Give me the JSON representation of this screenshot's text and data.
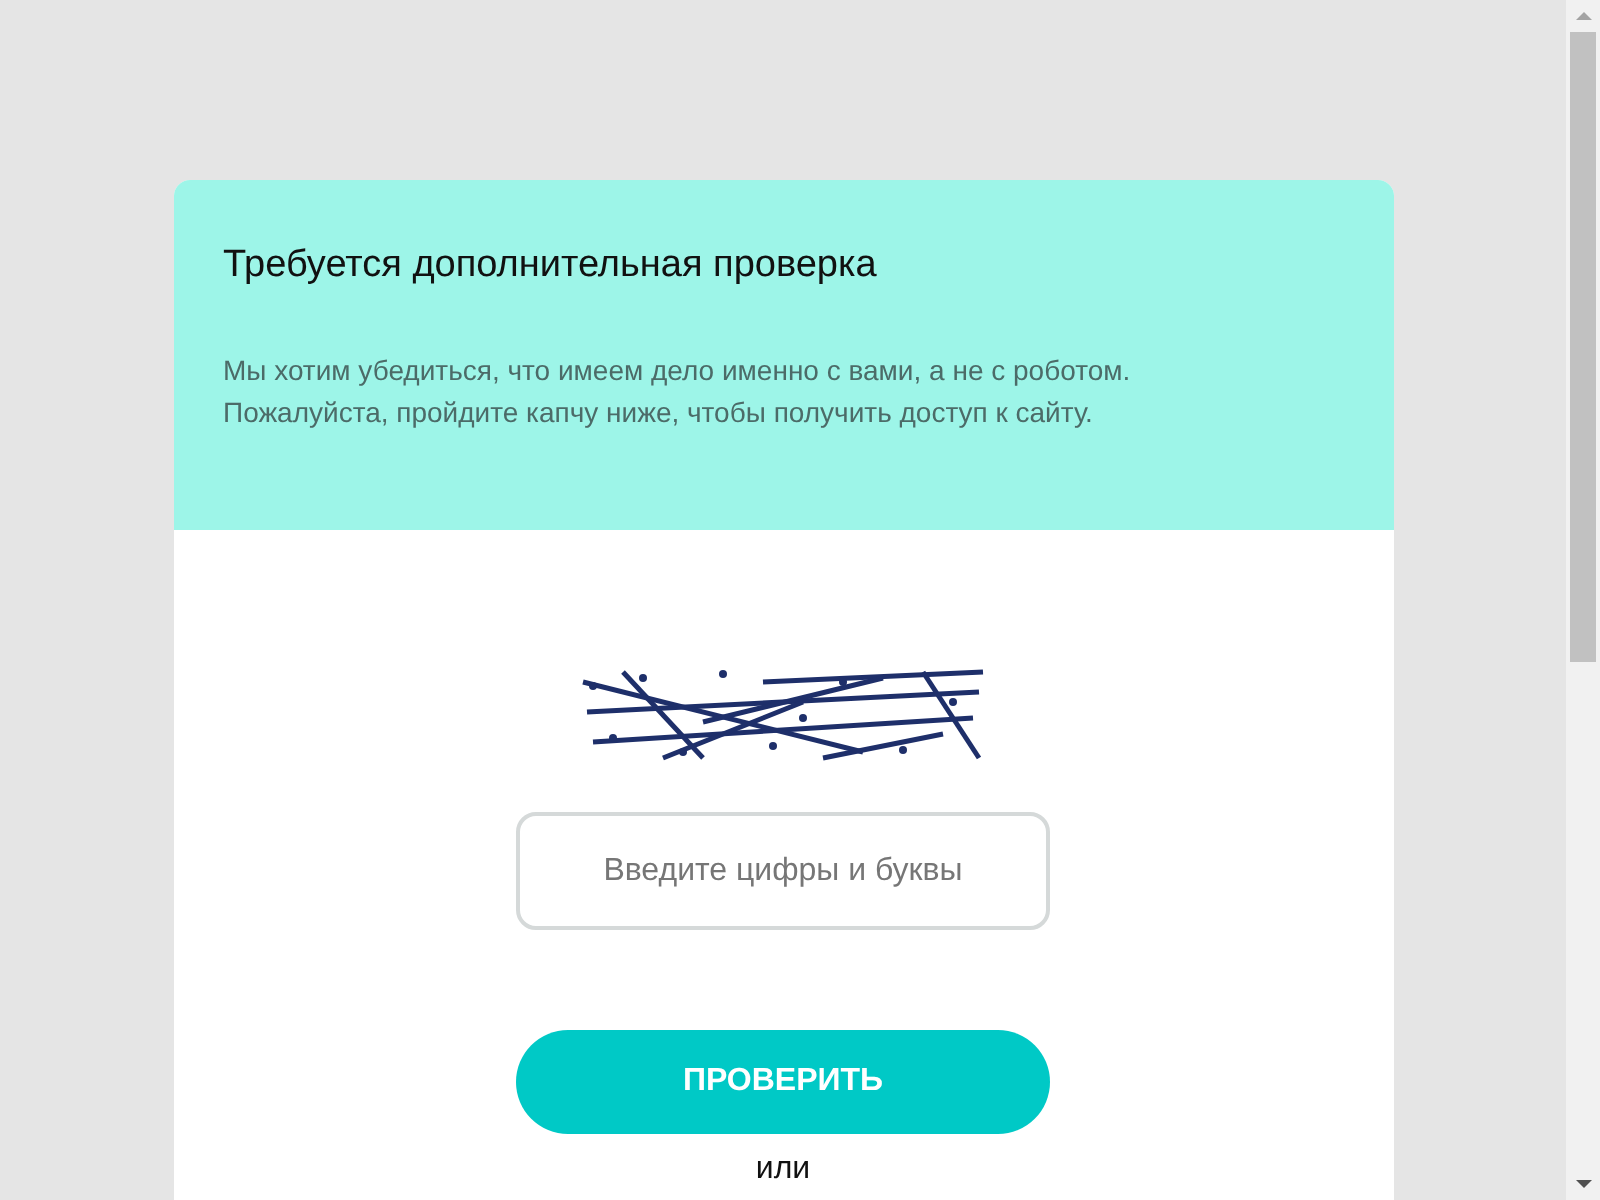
{
  "header": {
    "title": "Требуется дополнительная проверка",
    "description": "Мы хотим убедиться, что имеем дело именно с вами, а не с роботом. Пожалуйста, пройдите капчу ниже, чтобы получить доступ к сайту."
  },
  "answer_field": {
    "placeholder": "Введите цифры и буквы"
  },
  "submit_button": "ПРОВЕРИТЬ",
  "separator": "или"
}
